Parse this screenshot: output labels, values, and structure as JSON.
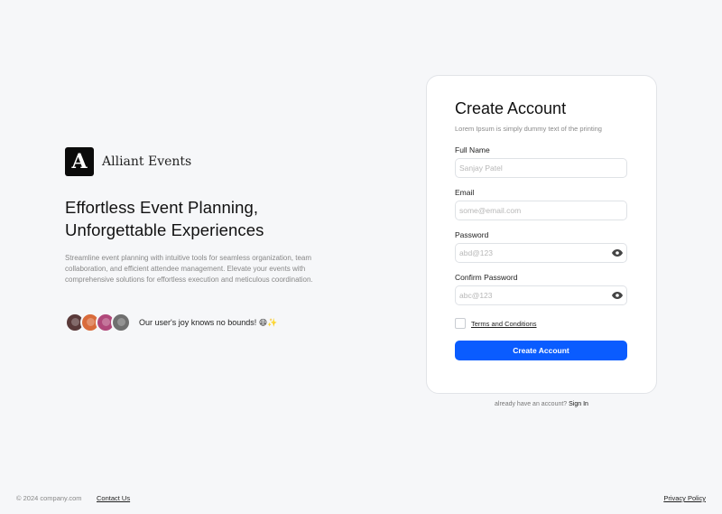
{
  "brand": {
    "logo_letter": "A",
    "name": "Alliant Events"
  },
  "hero": {
    "headline": "Effortless Event Planning, Unforgettable Experiences",
    "description": "Streamline event planning with intuitive tools for seamless organization, team collaboration, and efficient attendee management. Elevate your events with comprehensive solutions for effortless execution and meticulous coordination.",
    "social_proof": "Our user's joy knows no bounds! 😄✨",
    "avatars": [
      {
        "name": "avatar-1",
        "color": "#5a3a3a"
      },
      {
        "name": "avatar-2",
        "color": "#d96b3b"
      },
      {
        "name": "avatar-3",
        "color": "#b0487a"
      },
      {
        "name": "avatar-4",
        "color": "#6f6f6f"
      }
    ]
  },
  "form": {
    "title": "Create Account",
    "subtitle": "Lorem Ipsum is simply dummy text of the printing",
    "full_name": {
      "label": "Full Name",
      "placeholder": "Sanjay Patel",
      "value": ""
    },
    "email": {
      "label": "Email",
      "placeholder": "some@email.com",
      "value": ""
    },
    "password": {
      "label": "Password",
      "placeholder": "abd@123",
      "value": "",
      "icon": "eye-icon"
    },
    "confirm_password": {
      "label": "Confirm Password",
      "placeholder": "abc@123",
      "value": "",
      "icon": "eye-icon"
    },
    "terms_label": "Terms and Conditions",
    "terms_checked": false,
    "submit_label": "Create Account",
    "accent_color": "#0a5cff"
  },
  "signin": {
    "prompt": "already have an account?",
    "link": "Sign In"
  },
  "footer": {
    "copyright": "© 2024 company.com",
    "contact": "Contact Us",
    "privacy": "Privacy Policy"
  }
}
